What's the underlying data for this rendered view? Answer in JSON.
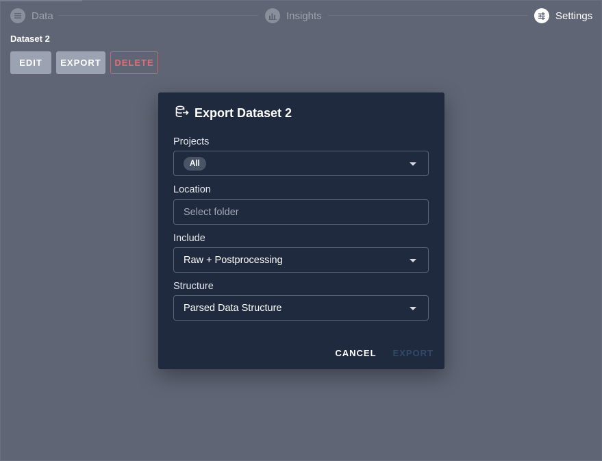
{
  "stepper": {
    "steps": [
      {
        "label": "Data",
        "icon": "list-icon",
        "state": "inactive"
      },
      {
        "label": "Insights",
        "icon": "bar-chart-icon",
        "state": "inactive"
      },
      {
        "label": "Settings",
        "icon": "sliders-icon",
        "state": "active"
      }
    ]
  },
  "dataset": {
    "title": "Dataset 2",
    "actions": {
      "edit": "EDIT",
      "export": "EXPORT",
      "delete": "DELETE"
    }
  },
  "dialog": {
    "icon": "database-export-icon",
    "title": "Export Dataset 2",
    "fields": {
      "projects": {
        "label": "Projects",
        "chip": "All"
      },
      "location": {
        "label": "Location",
        "placeholder": "Select folder",
        "value": ""
      },
      "include": {
        "label": "Include",
        "value": "Raw + Postprocessing"
      },
      "structure": {
        "label": "Structure",
        "value": "Parsed Data Structure"
      }
    },
    "buttons": {
      "cancel": "CANCEL",
      "export": "EXPORT"
    }
  },
  "colors": {
    "backdrop": "#5f6575",
    "dialog_bg": "#1f2a3e",
    "delete_red": "#e86a72",
    "export_disabled": "#2f4b6a"
  }
}
